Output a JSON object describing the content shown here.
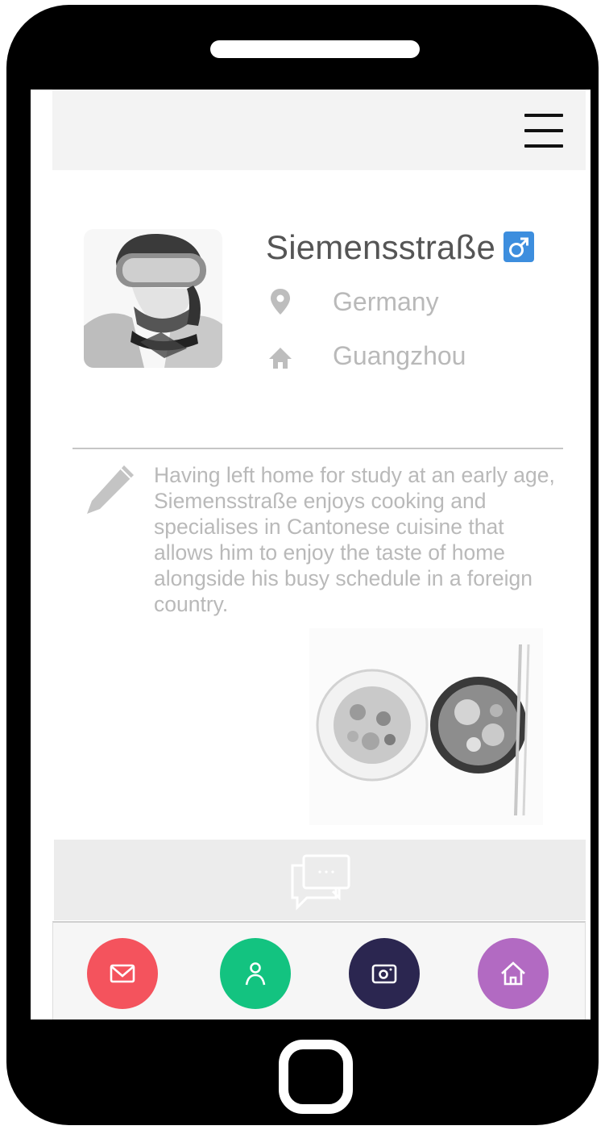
{
  "profile": {
    "name": "Siemensstraße",
    "gender_symbol": "♂",
    "gender_icon": "male-icon",
    "location_icon": "map-pin-icon",
    "location": "Germany",
    "home_icon": "home-icon",
    "hometown": "Guangzhou",
    "avatar": "watercolor-portrait-with-goggles"
  },
  "bio": {
    "icon": "pencil-icon",
    "text": "Having left home for study at an early age, Siemensstraße enjoys cooking and specialises in Cantonese cuisine that allows him to enjoy the taste of home alongside his busy schedule in a foreign country."
  },
  "media": {
    "image": "watercolor-food-bowls"
  },
  "chat": {
    "icon": "chat-bubbles-icon"
  },
  "nav": {
    "items": [
      {
        "icon": "mail-icon",
        "color": "#f4535d"
      },
      {
        "icon": "user-icon",
        "color": "#13c380"
      },
      {
        "icon": "camera-icon",
        "color": "#2b2650"
      },
      {
        "icon": "home-icon",
        "color": "#b26ac2"
      }
    ]
  },
  "colors": {
    "gender_badge": "#3d8ede",
    "text_primary": "#555555",
    "text_muted": "#b9b9b9",
    "topbar_bg": "#f3f3f3",
    "chatbar_bg": "#ececec"
  }
}
